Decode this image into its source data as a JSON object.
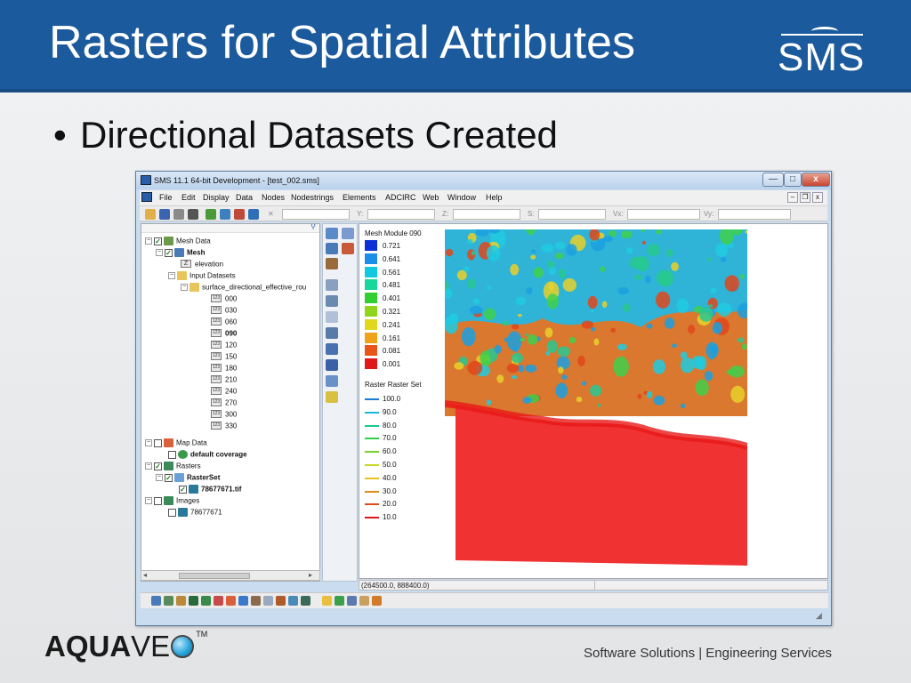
{
  "slide": {
    "title": "Rasters for Spatial Attributes",
    "logo_text": "SMS",
    "bullet": "Directional Datasets Created",
    "footer_brand_bold": "AQUA",
    "footer_brand_light": "VE",
    "footer_tm": "TM",
    "footer_tagline": "Software Solutions | Engineering Services",
    "colors": {
      "header_bg": "#1b5a9c",
      "header_text": "#ffffff"
    }
  },
  "window": {
    "title": "SMS 11.1 64-bit Development - [test_002.sms]",
    "min_label": "—",
    "max_label": "□",
    "close_label": "x",
    "menu": [
      "File",
      "Edit",
      "Display",
      "Data",
      "Nodes",
      "Nodestrings",
      "Elements",
      "ADCIRC",
      "Web",
      "Window",
      "Help"
    ],
    "mdi_min": "–",
    "mdi_restore": "❐",
    "mdi_close": "x",
    "coord_labels": {
      "x": "X:",
      "y": "Y:",
      "z": "Z:",
      "s": "S:",
      "vx": "Vx:",
      "vy": "Vy:"
    },
    "status_coords": "(264500.0, 888400.0)"
  },
  "tree": {
    "mesh_data": "Mesh Data",
    "mesh": "Mesh",
    "elevation": "elevation",
    "input_datasets": "Input Datasets",
    "directional_folder": "surface_directional_effective_rou",
    "datasets": [
      "000",
      "030",
      "060",
      "090",
      "120",
      "150",
      "180",
      "210",
      "240",
      "270",
      "300",
      "330"
    ],
    "selected_dataset": "090",
    "map_data": "Map Data",
    "default_coverage": "default coverage",
    "rasters": "Rasters",
    "raster_set": "RasterSet",
    "raster_file": "78677671.tif",
    "images": "Images",
    "image_file": "78677671",
    "ds_icon_text": "123",
    "z_icon_text": "Z",
    "expand_minus": "−",
    "check_mark": "✓"
  },
  "legend": {
    "mesh_title": "Mesh Module 090",
    "mesh_values": [
      "0.721",
      "0.641",
      "0.561",
      "0.481",
      "0.401",
      "0.321",
      "0.241",
      "0.161",
      "0.081",
      "0.001"
    ],
    "mesh_colors": [
      "#0a2fd6",
      "#1b8fe8",
      "#10c8e0",
      "#18d79a",
      "#2fd02f",
      "#8fd51a",
      "#e0d81c",
      "#f0a21a",
      "#e8561a",
      "#e01818"
    ],
    "raster_title": "Raster Raster Set",
    "raster_values": [
      "100.0",
      "90.0",
      "80.0",
      "70.0",
      "60.0",
      "50.0",
      "40.0",
      "30.0",
      "20.0",
      "10.0"
    ],
    "raster_colors": [
      "#1a7ad8",
      "#18b8d8",
      "#18c890",
      "#2ed04a",
      "#7ad02a",
      "#c8d820",
      "#e8c020",
      "#e08a1a",
      "#e04a1a",
      "#d81818"
    ]
  }
}
